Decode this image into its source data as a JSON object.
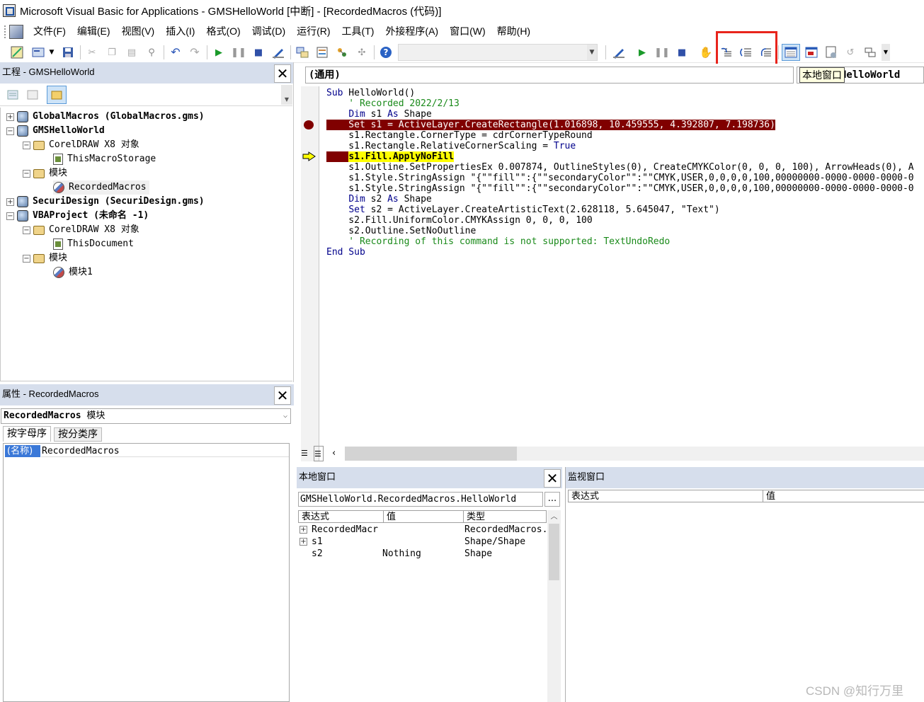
{
  "window": {
    "title": "Microsoft Visual Basic for Applications - GMSHelloWorld [中断] - [RecordedMacros (代码)]"
  },
  "menu": {
    "items": [
      "文件(F)",
      "编辑(E)",
      "视图(V)",
      "插入(I)",
      "格式(O)",
      "调试(D)",
      "运行(R)",
      "工具(T)",
      "外接程序(A)",
      "窗口(W)",
      "帮助(H)"
    ]
  },
  "toolbar": {
    "tooltip": "本地窗口",
    "combo_value": ""
  },
  "project_panel": {
    "title": "工程 - GMSHelloWorld",
    "tree": [
      {
        "label": "GlobalMacros (GlobalMacros.gms)",
        "icon": "project-icon",
        "bold": true
      },
      {
        "label": "GMSHelloWorld",
        "icon": "project-icon",
        "bold": true
      },
      {
        "label": "CorelDRAW X8 对象",
        "icon": "folder-icon",
        "bold": false
      },
      {
        "label": "ThisMacroStorage",
        "icon": "document-icon",
        "bold": false
      },
      {
        "label": "模块",
        "icon": "folder-icon",
        "bold": false
      },
      {
        "label": "RecordedMacros",
        "icon": "module-icon",
        "bold": false
      },
      {
        "label": "SecuriDesign (SecuriDesign.gms)",
        "icon": "project-icon",
        "bold": true
      },
      {
        "label": "VBAProject (未命名 -1)",
        "icon": "project-icon",
        "bold": true
      },
      {
        "label": "CorelDRAW X8 对象",
        "icon": "folder-icon",
        "bold": false
      },
      {
        "label": "ThisDocument",
        "icon": "document-icon",
        "bold": false
      },
      {
        "label": "模块",
        "icon": "folder-icon",
        "bold": false
      },
      {
        "label": "模块1",
        "icon": "module-icon",
        "bold": false
      }
    ]
  },
  "properties_panel": {
    "title": "属性 - RecordedMacros",
    "object_name": "RecordedMacros",
    "object_type": "模块",
    "tabs": [
      "按字母序",
      "按分类序"
    ],
    "row_name": "(名称)",
    "row_value": "RecordedMacros"
  },
  "code_window": {
    "object_combo": "(通用)",
    "proc_combo": "HelloWorld",
    "lines": [
      "Sub HelloWorld()",
      "    ' Recorded 2022/2/13",
      "    Dim s1 As Shape",
      "    Set s1 = ActiveLayer.CreateRectangle(1.016898, 10.459555, 4.392807, 7.198736)",
      "    s1.Rectangle.CornerType = cdrCornerTypeRound",
      "    s1.Rectangle.RelativeCornerScaling = True",
      "    s1.Fill.ApplyNoFill",
      "    s1.Outline.SetPropertiesEx 0.007874, OutlineStyles(0), CreateCMYKColor(0, 0, 0, 100), ArrowHeads(0), A",
      "    s1.Style.StringAssign \"{\"\"fill\"\":{\"\"secondaryColor\"\":\"\"CMYK,USER,0,0,0,0,100,00000000-0000-0000-0000-0",
      "    s1.Style.StringAssign \"{\"\"fill\"\":{\"\"secondaryColor\"\":\"\"CMYK,USER,0,0,0,0,100,00000000-0000-0000-0000-0",
      "    Dim s2 As Shape",
      "    Set s2 = ActiveLayer.CreateArtisticText(2.628118, 5.645047, \"Text\")",
      "    s2.Fill.UniformColor.CMYKAssign 0, 0, 0, 100",
      "    s2.Outline.SetNoOutline",
      "    ' Recording of this command is not supported: TextUndoRedo",
      "End Sub"
    ]
  },
  "locals_panel": {
    "title": "本地窗口",
    "context": "GMSHelloWorld.RecordedMacros.HelloWorld",
    "ellipsis": "...",
    "columns": [
      "表达式",
      "值",
      "类型"
    ],
    "rows": [
      {
        "expr": "RecordedMacr",
        "value": "",
        "type": "RecordedMacros.",
        "expandable": true
      },
      {
        "expr": "s1",
        "value": "",
        "type": "Shape/Shape",
        "expandable": true
      },
      {
        "expr": "s2",
        "value": "Nothing",
        "type": "Shape",
        "expandable": false
      }
    ]
  },
  "watch_panel": {
    "title": "监视窗口",
    "columns": [
      "表达式",
      "值"
    ]
  },
  "watermark": "CSDN @知行万里",
  "colors": {
    "panel_title_bg": "#d6deec",
    "breakpoint": "#800000",
    "current_line": "#ffff00",
    "annotation": "#e8241c"
  }
}
